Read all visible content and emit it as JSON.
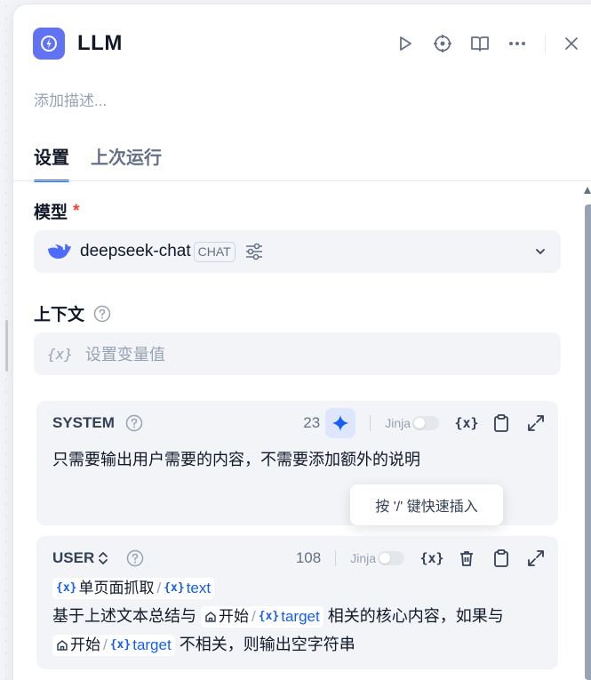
{
  "header": {
    "title": "LLM",
    "description_placeholder": "添加描述..."
  },
  "tabs": [
    {
      "label": "设置",
      "active": true
    },
    {
      "label": "上次运行",
      "active": false
    }
  ],
  "model": {
    "label": "模型",
    "required_mark": "*",
    "name": "deepseek-chat",
    "badge": "CHAT"
  },
  "context": {
    "label": "上下文",
    "var_icon": "{x}",
    "placeholder": "设置变量值"
  },
  "system_prompt": {
    "title": "SYSTEM",
    "count": "23",
    "jinja_label": "Jinja",
    "jinja_enabled": false,
    "var_icon": "{x}",
    "text": "只需要输出用户需要的内容，不需要添加额外的说明",
    "tooltip": "按 '/' 键快速插入"
  },
  "user_prompt": {
    "title": "USER",
    "count": "108",
    "jinja_label": "Jinja",
    "jinja_enabled": false,
    "var_icon": "{x}",
    "line1_node": "单页面抓取",
    "line1_var": "text",
    "line2_prefix": "基于上述文本总结与",
    "node_start": "开始",
    "var_target": "target",
    "line2_suffix": "相关的核心内容，如果与",
    "line3_suffix": "不相关，则输出空字符串",
    "slash": "/",
    "chip_var_icon": "{x}"
  },
  "colors": {
    "accent": "#155eef",
    "app_icon_bg": "#6172f3",
    "required": "#f04438"
  }
}
